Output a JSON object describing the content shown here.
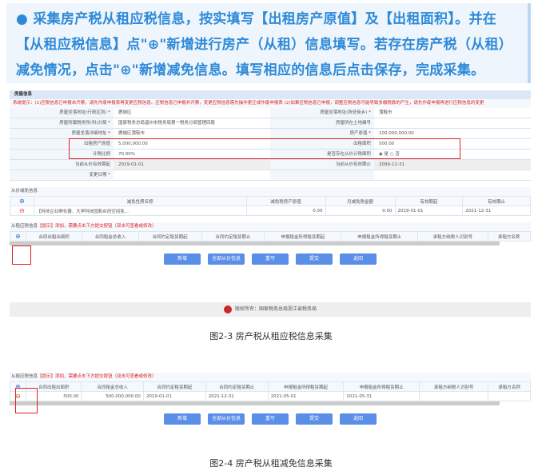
{
  "callout": {
    "lines": [
      "● 采集房产税从租应税信息，按实填写【出租房产原值】及【出租面积】。并在",
      "【从租应税信息】点\"⊕\"新增进行房产（从租）信息填写。若存在房产税（从租）",
      "减免情况，点击\"⊕\"新增减免信息。填写相应的信息后点击保存，完成采集。"
    ]
  },
  "fig1": {
    "panel_title": "房屋信息",
    "warning": "系统提示：(1)应税信息已申报未开票，请先作废申报表再变更应税信息。应税信息已申报并开票，变更应税信息需先操作更正或作废申报表 (2)如果应税信息已申报，调整应税信息可能导致多缴税款的产生，请先作废申报再进行应税信息的变更",
    "rows": [
      {
        "l": "房屋坐落地址(行政区划)",
        "req": true,
        "v": "鹿城区",
        "r_l": "房屋坐落地址(所处街乡)",
        "r_req": true,
        "r_v": "蒲鞋市"
      },
      {
        "l": "房屋所属税务所(科)分局",
        "req": true,
        "v": "国家税务总局温州市税务局第一税务分局管理四股",
        "r_l": "房屋所在土地编号",
        "r_req": false,
        "r_v": ""
      },
      {
        "l": "房屋坐落详细地址",
        "req": true,
        "v": "鹿城区蒲鞋市",
        "r_l": "房产原值",
        "r_req": true,
        "r_v": "100,000,000.00"
      },
      {
        "l": "出租房产原值",
        "req": false,
        "v": "5,000,000.00",
        "r_l": "出租面积",
        "r_req": false,
        "r_v": "500.00"
      },
      {
        "l": "计税比例",
        "req": false,
        "v": "70.00%",
        "r_l": "是否存在从价计税面积",
        "r_req": false,
        "r_v": "◉ 是  ○ 否"
      },
      {
        "l": "当前从价有效期起",
        "req": false,
        "v": "2019-01-01",
        "r_l": "当前从价有效期止",
        "r_req": false,
        "r_v": "2099-12-31"
      },
      {
        "l": "变更日期",
        "req": true,
        "v": "",
        "r_l": "",
        "r_req": false,
        "r_v": ""
      }
    ],
    "relief": {
      "title": "从价减免信息",
      "headers": [
        "减免性质名称",
        "减免税房产原值",
        "月减免税金额",
        "有效期起",
        "有效期止"
      ],
      "row": [
        "【科技企业孵化器、大学科技园和众创空间免...",
        "0.00",
        "0.00",
        "2019-01-01",
        "2021-12-31"
      ]
    },
    "rent": {
      "title": "从租应税信息",
      "hint": "【提示】添加，需要点击下方提交按钮（双击可查看或修改）",
      "headers": [
        "合同出租出面积",
        "合同租金总收入",
        "合同约定租赁期起",
        "合同约定租赁期止",
        "申报租金所得租赁期起",
        "申报租金所得租赁期止",
        "承租方纳税人识别号",
        "承租方名称"
      ]
    },
    "buttons": [
      "新增",
      "全部从价信息",
      "重写",
      "提交",
      "返回"
    ],
    "footer": "版权所有：国家税务总局浙江省税务局"
  },
  "caption1": "图2-3 房产税从租应税信息采集",
  "fig2": {
    "title": "从租应税信息",
    "hint": "【提示】添加，需要点击下方提交按钮（双击可查看或修改）",
    "headers": [
      "合同出租出面积",
      "合同租金总收入",
      "合同约定租赁期起",
      "合同约定租赁期止",
      "申报租金所得租赁期起",
      "申报租金所得租赁期止",
      "承租方纳税人识别号",
      "承租方名称"
    ],
    "row": [
      "500.00",
      "500,000,000.00",
      "2019-01-01",
      "2021-12-31",
      "2021-05-01",
      "2021-05-31",
      "",
      ""
    ],
    "buttons": [
      "新增",
      "全部从价信息",
      "重写",
      "提交",
      "返回"
    ]
  },
  "caption2": "图2-4 房产税从租减免信息采集"
}
